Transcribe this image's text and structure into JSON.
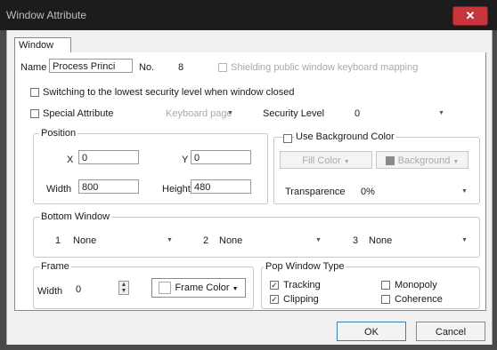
{
  "window": {
    "title": "Window Attribute",
    "close_glyph": "✕"
  },
  "tabs": [
    {
      "label": "Window"
    }
  ],
  "row1": {
    "name_label": "Name",
    "name_value": "Process Princi",
    "no_label": "No.",
    "no_value": "8",
    "shielding_label": "Shielding public window keyboard mapping"
  },
  "switching": {
    "label": "Switching to the lowest security level when window closed"
  },
  "row3": {
    "special_label": "Special Attribute",
    "keyboard_label": "Keyboard page",
    "security_label": "Security Level",
    "security_value": "0"
  },
  "position": {
    "title": "Position",
    "x_label": "X",
    "x_value": "0",
    "y_label": "Y",
    "y_value": "0",
    "width_label": "Width",
    "width_value": "800",
    "height_label": "Height",
    "height_value": "480"
  },
  "background": {
    "title": "Use Background Color",
    "fill_label": "Fill Color",
    "background_label": "Background",
    "transparence_label": "Transparence",
    "transparence_value": "0%"
  },
  "bottom_window": {
    "title": "Bottom Window",
    "items": [
      {
        "index": "1",
        "value": "None"
      },
      {
        "index": "2",
        "value": "None"
      },
      {
        "index": "3",
        "value": "None"
      }
    ]
  },
  "frame": {
    "title": "Frame",
    "width_label": "Width",
    "width_value": "0",
    "color_label": "Frame Color"
  },
  "pop_type": {
    "title": "Pop Window Type",
    "options": [
      {
        "label": "Tracking",
        "checked": true
      },
      {
        "label": "Monopoly",
        "checked": false
      },
      {
        "label": "Clipping",
        "checked": true
      },
      {
        "label": "Coherence",
        "checked": false
      }
    ],
    "check_glyph": "✓"
  },
  "buttons": {
    "ok": "OK",
    "cancel": "Cancel"
  },
  "icons": {
    "dropdown": "▼",
    "spin_up": "▲",
    "spin_down": "▼"
  }
}
